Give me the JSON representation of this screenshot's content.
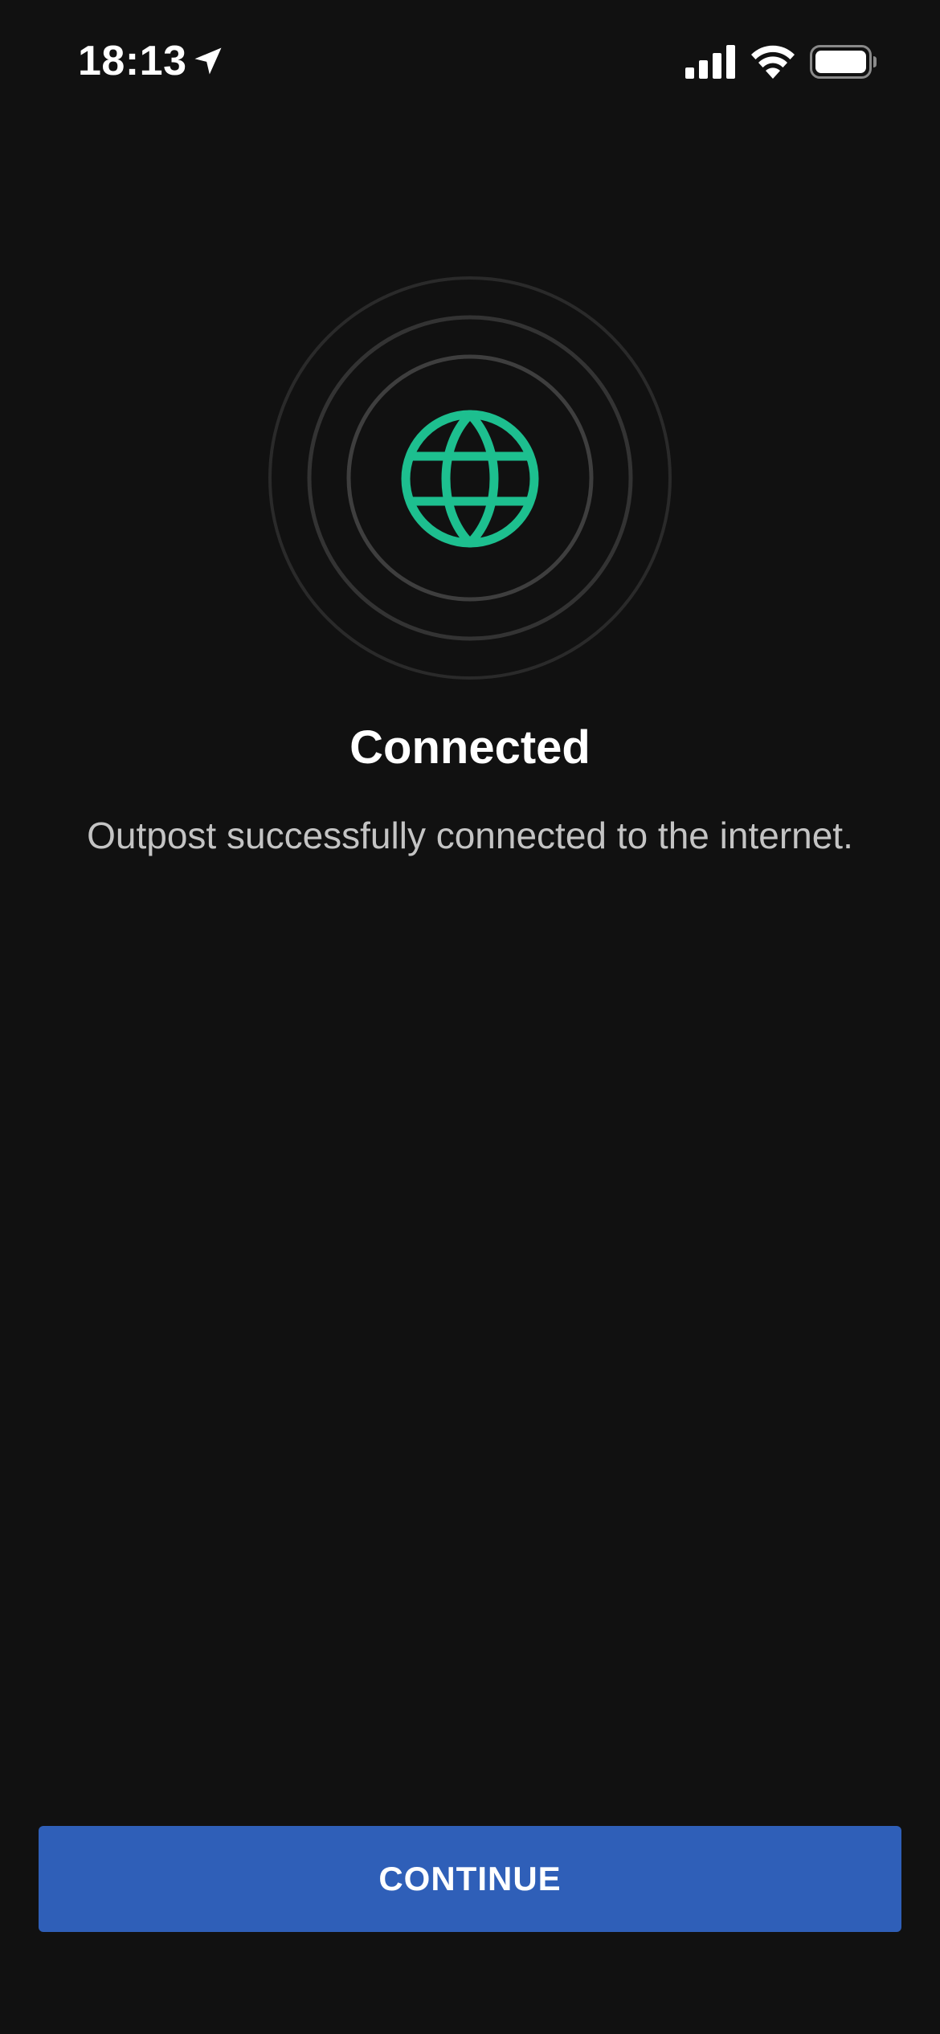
{
  "status_bar": {
    "time": "18:13",
    "location_icon": "location-arrow-icon",
    "signal_icon": "cellular-signal-icon",
    "wifi_icon": "wifi-icon",
    "battery_icon": "battery-icon"
  },
  "hero": {
    "icon": "globe-icon",
    "icon_color": "#1dbf8f"
  },
  "content": {
    "title": "Connected",
    "message": "Outpost successfully connected to the internet."
  },
  "actions": {
    "continue_label": "CONTINUE",
    "continue_color": "#2f5fb8"
  },
  "colors": {
    "background": "#111111",
    "title": "#ffffff",
    "message": "#c4c4c4"
  }
}
